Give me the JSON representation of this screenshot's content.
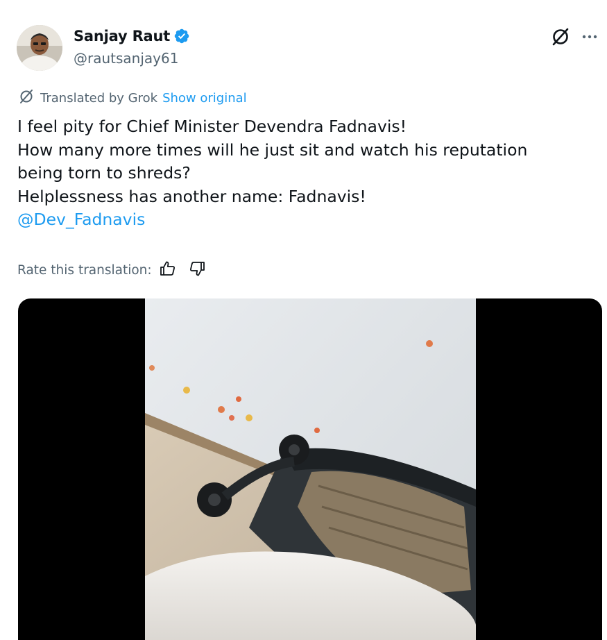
{
  "author": {
    "display_name": "Sanjay Raut",
    "handle": "@rautsanjay61",
    "verified": true
  },
  "translation": {
    "label": "Translated by Grok",
    "show_original": "Show original"
  },
  "tweet": {
    "lines": [
      "I feel pity for Chief Minister Devendra Fadnavis!",
      "How many more times will he just sit and watch his reputation",
      "being torn to shreds?",
      "Helplessness has another name: Fadnavis!"
    ],
    "mention": "@Dev_Fadnavis"
  },
  "rate": {
    "label": "Rate this translation:"
  },
  "icons": {
    "verified": "verified-badge-icon",
    "grok": "grok-icon",
    "more": "more-icon",
    "thumbs_up": "thumbs-up-icon",
    "thumbs_down": "thumbs-down-icon"
  },
  "colors": {
    "accent": "#1d9bf0",
    "secondary_text": "#536471",
    "primary_text": "#0f1419"
  }
}
